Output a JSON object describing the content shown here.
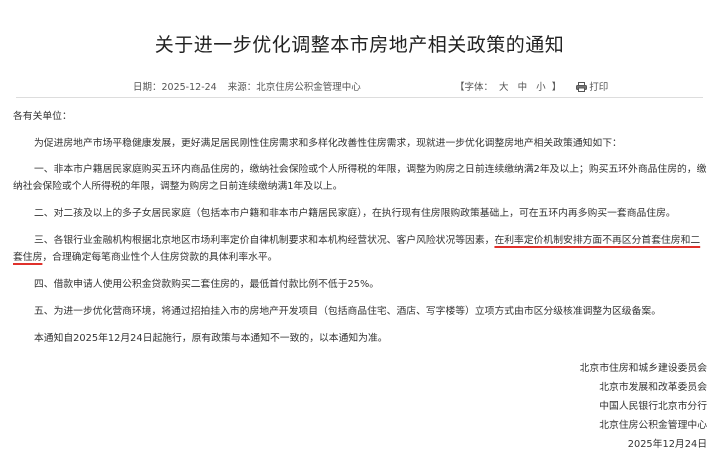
{
  "document": {
    "title": "关于进一步优化调整本市房地产相关政策的通知",
    "meta": {
      "date": "日期：2025-12-24",
      "source": "来源：北京住房公积金管理中心",
      "font_label": "【字体：",
      "font_large": "大",
      "font_medium": "中",
      "font_small": "小",
      "font_close": "】",
      "print_label": "打印",
      "print_icon": "printer-icon"
    },
    "greeting": "各有关单位：",
    "intro": "为促进房地产市场平稳健康发展，更好满足居民刚性住房需求和多样化改善性住房需求，现就进一步优化调整房地产相关政策通知如下：",
    "item1": "一、非本市户籍居民家庭购买五环内商品住房的，缴纳社会保险或个人所得税的年限，调整为购房之日前连续缴纳满2年及以上；购买五环外商品住房的，缴纳社会保险或个人所得税的年限，调整为购房之日前连续缴纳满1年及以上。",
    "item2": "二、对二孩及以上的多子女居民家庭（包括本市户籍和非本市户籍居民家庭），在执行现有住房限购政策基础上，可在五环内再多购买一套商品住房。",
    "item3_pre": "三、各银行业金融机构根据北京地区市场利率定价自律机制要求和本机构经营状况、客户风险状况等因素，",
    "item3_highlight": "在利率定价机制安排方面不再区分首套住房和二套住房",
    "item3_post": "，合理确定每笔商业性个人住房贷款的具体利率水平。",
    "item4": "四、借款申请人使用公积金贷款购买二套住房的，最低首付款比例不低于25%。",
    "item5": "五、为进一步优化营商环境，将通过招拍挂入市的房地产开发项目（包括商品住宅、酒店、写字楼等）立项方式由市区分级核准调整为区级备案。",
    "closing": "本通知自2025年12月24日起施行，原有政策与本通知不一致的，以本通知为准。",
    "signers": [
      "北京市住房和城乡建设委员会",
      "北京市发展和改革委员会",
      "中国人民银行北京市分行",
      "北京住房公积金管理中心"
    ],
    "sign_date": "2025年12月24日",
    "highlight_color": "#e0312b"
  }
}
